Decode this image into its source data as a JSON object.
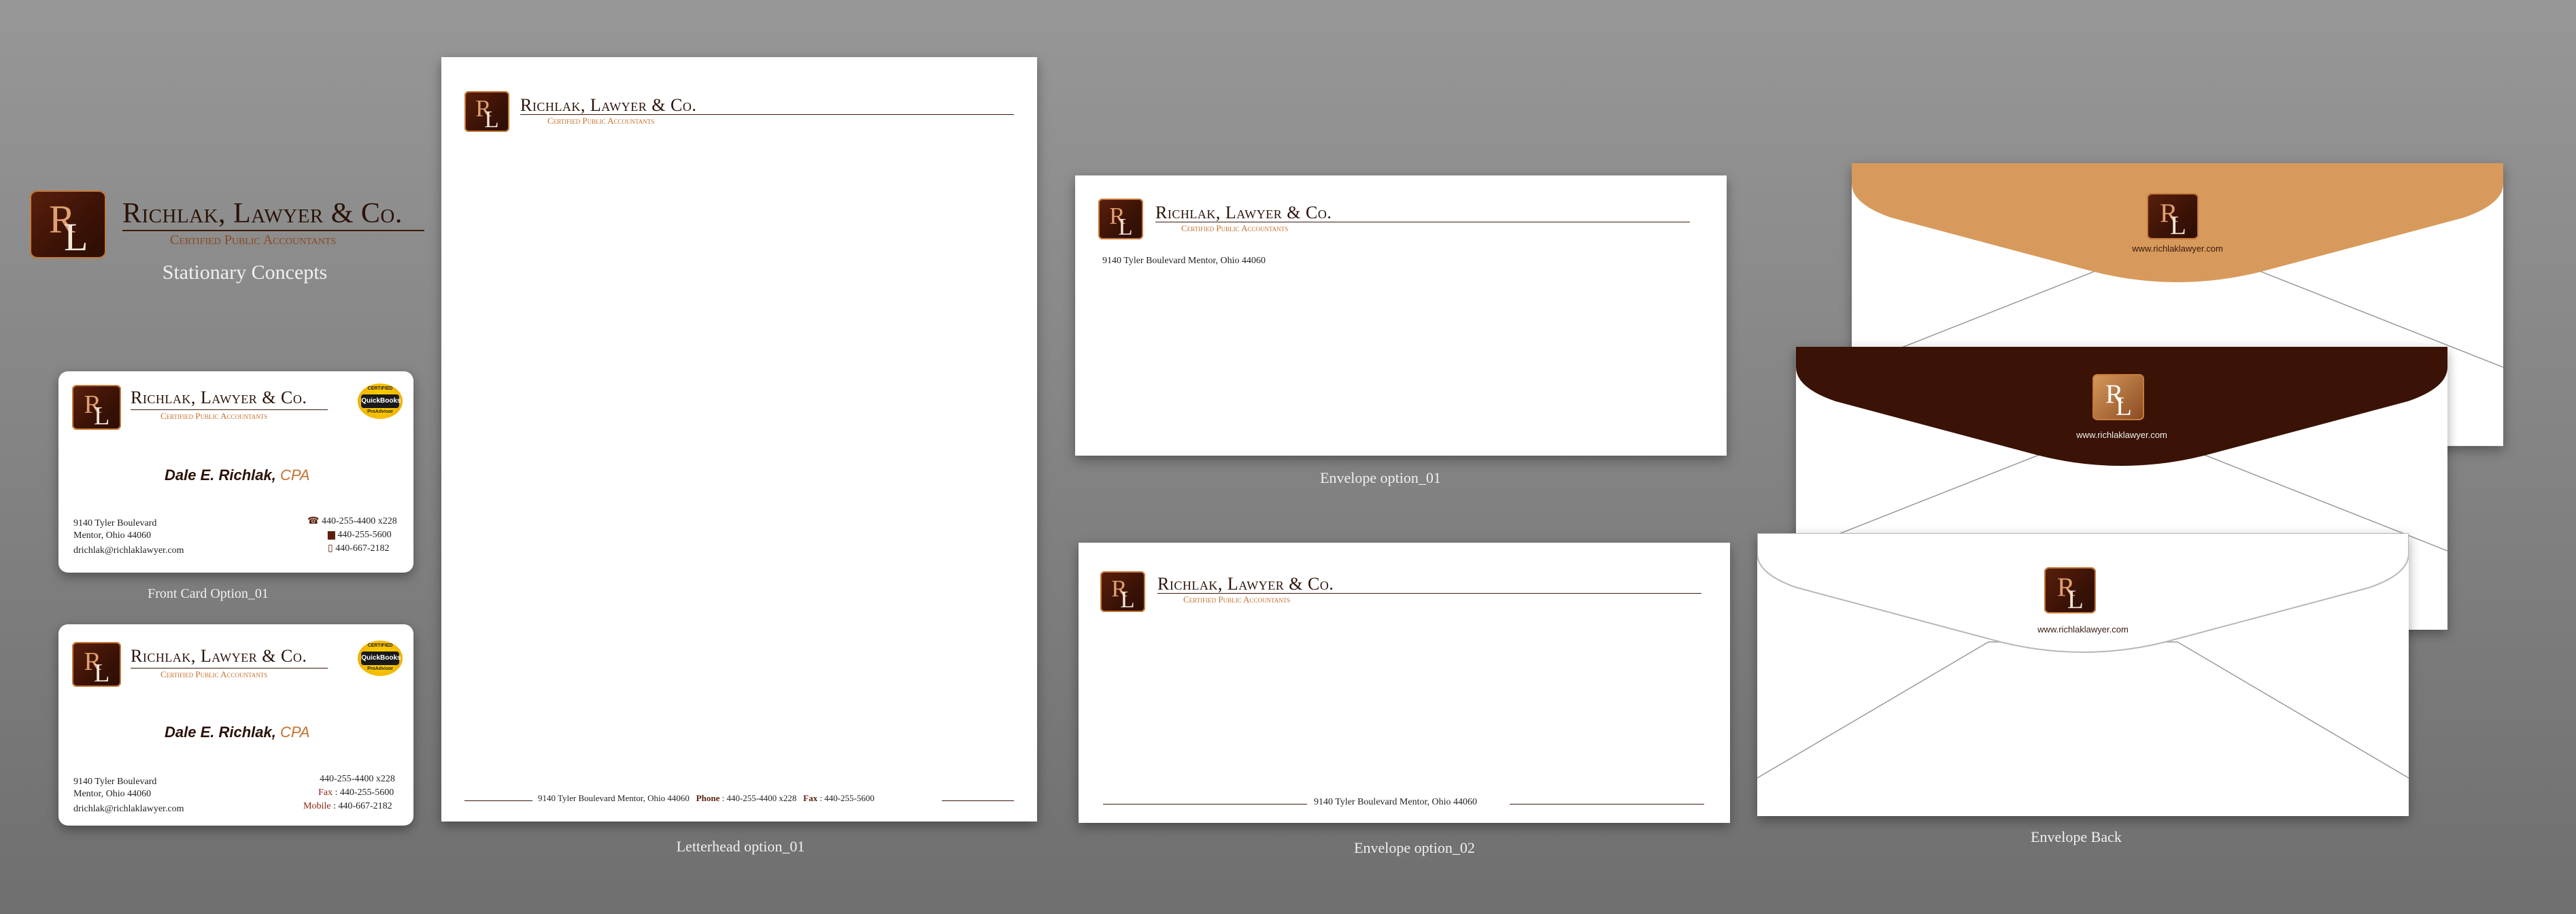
{
  "colors": {
    "brand_dark": "#3a1206",
    "brand_accent": "#c6702c",
    "flap_orange": "#d79a5c",
    "flap_brown": "#3a1206"
  },
  "brand": {
    "firm_name": "Richlak, Lawyer & Co.",
    "tagline": "Certified Public Accountants",
    "monogram": "RL",
    "subtitle": "Stationary Concepts"
  },
  "card1": {
    "name": "Dale E. Richlak,",
    "title": "CPA",
    "address1": "9140 Tyler Boulevard",
    "address2": "Mentor, Ohio 44060",
    "email": "drichlak@richlaklawyer.com",
    "phone": "440-255-4400 x228",
    "fax": "440-255-5600",
    "mobile": "440-667-2182",
    "badge_top": "CERTIFIED",
    "badge_main": "QuickBooks",
    "badge_bottom": "ProAdvisor",
    "caption": "Front Card Option_01"
  },
  "card2": {
    "name": "Dale E. Richlak,",
    "title": "CPA",
    "address1": "9140 Tyler Boulevard",
    "address2": "Mentor, Ohio 44060",
    "email": "drichlak@richlaklawyer.com",
    "phone": "440-255-4400 x228",
    "fax_label": "Fax",
    "fax": "440-255-5600",
    "mobile_label": "Mobile",
    "mobile": "440-667-2182",
    "badge_top": "CERTIFIED",
    "badge_main": "QuickBooks",
    "badge_bottom": "ProAdvisor"
  },
  "letterhead": {
    "footer_address": "9140 Tyler Boulevard Mentor, Ohio 44060",
    "phone_label": "Phone",
    "phone": "440-255-4400 x228",
    "fax_label": "Fax",
    "fax": "440-255-5600",
    "caption": "Letterhead option_01"
  },
  "envelope1": {
    "address": "9140 Tyler Boulevard Mentor, Ohio 44060",
    "caption": "Envelope option_01"
  },
  "envelope2": {
    "footer_address": "9140 Tyler Boulevard Mentor, Ohio 44060",
    "caption": "Envelope option_02"
  },
  "envelope_back": {
    "url": "www.richlaklawyer.com",
    "caption": "Envelope Back"
  }
}
